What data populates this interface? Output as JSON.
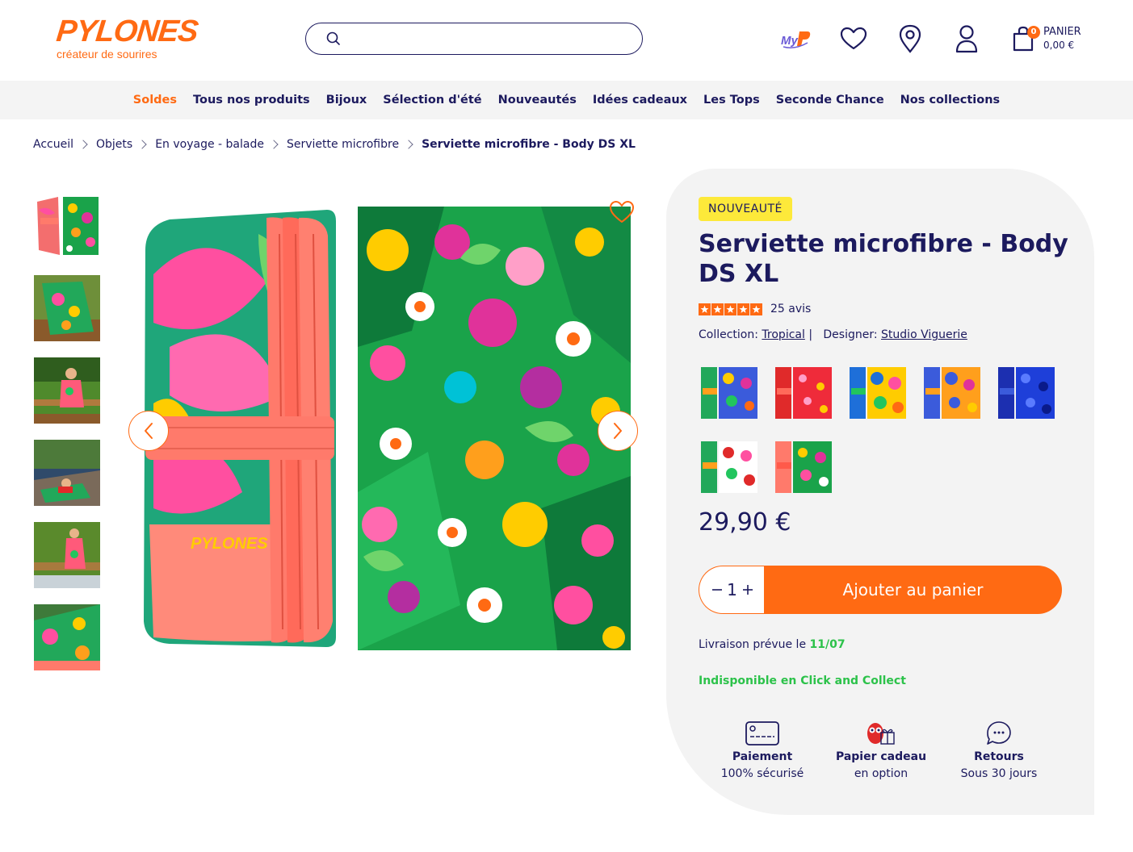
{
  "brand": {
    "name": "PYLONES",
    "tagline": "créateur de sourires",
    "accent_color": "#ff6a13",
    "navy_color": "#1c1a5e"
  },
  "search": {
    "placeholder": ""
  },
  "header_icons": [
    "myp-loyalty-icon",
    "heart-icon",
    "location-pin-icon",
    "user-icon",
    "shopping-bag-icon"
  ],
  "cart": {
    "count": "0",
    "label": "PANIER",
    "total": "0,00 €"
  },
  "nav": {
    "items": [
      "Soldes",
      "Tous nos produits",
      "Bijoux",
      "Sélection d'été",
      "Nouveautés",
      "Idées cadeaux",
      "Les Tops",
      "Seconde Chance",
      "Nos collections"
    ]
  },
  "breadcrumb": {
    "items": [
      "Accueil",
      "Objets",
      "En voyage - balade",
      "Serviette microfibre"
    ],
    "current": "Serviette microfibre - Body DS XL"
  },
  "product": {
    "badge": "NOUVEAUTÉ",
    "title": "Serviette microfibre - Body DS XL",
    "rating_stars": 5,
    "reviews": "25 avis",
    "collection_label": "Collection:",
    "collection": "Tropical",
    "separator": "|",
    "designer_label": "Designer:",
    "designer": "Studio Viguerie",
    "price": "29,90 €",
    "quantity": "1",
    "add_to_cart": "Ajouter au panier",
    "delivery_label": "Livraison prévue le",
    "delivery_date": "11/07",
    "click_collect": "Indisponible en Click and Collect"
  },
  "perks": [
    {
      "title": "Paiement",
      "subtitle": "100% sécurisé",
      "icon": "credit-card-icon"
    },
    {
      "title": "Papier cadeau",
      "subtitle": "en option",
      "icon": "gift-owl-icon"
    },
    {
      "title": "Retours",
      "subtitle": "Sous 30 jours",
      "icon": "chat-bubble-icon"
    }
  ]
}
